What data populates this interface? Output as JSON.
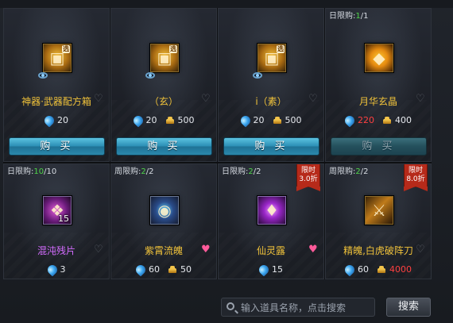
{
  "colors": {
    "item_name": "#f0c23a",
    "item_name_purple": "#d46cff",
    "limit_current": "#4fd44a",
    "price_red": "#ff4040",
    "buy_button": "#2c8fb5",
    "ribbon": "#b62a1a"
  },
  "currency_icons": {
    "gem": "gem-icon",
    "gold": "gold-icon"
  },
  "items": [
    {
      "name": "神器·武器配方箱",
      "icon": "weapon-recipe-chest-icon",
      "tag": "选",
      "gem_price": "20",
      "buy_label": "购 买"
    },
    {
      "name": "（玄）",
      "icon": "xuan-chest-icon",
      "tag": "选",
      "gem_price": "20",
      "gold_price": "500",
      "buy_label": "购 买"
    },
    {
      "name": "i（素）",
      "icon": "su-chest-icon",
      "tag": "选",
      "gem_price": "20",
      "gold_price": "500",
      "buy_label": "购 买"
    },
    {
      "name": "月华玄晶",
      "icon": "moon-crystal-icon",
      "limit_label": "日限购:",
      "limit_current": "1",
      "limit_total": "1",
      "gem_price": "220",
      "gold_price": "400",
      "buy_label": "购 买"
    },
    {
      "name": "混沌残片",
      "icon": "chaos-fragment-icon",
      "qty": "15",
      "limit_label": "日限购:",
      "limit_current": "10",
      "limit_total": "10",
      "gem_price": "3"
    },
    {
      "name": "紫霄流魄",
      "icon": "zixiao-soul-icon",
      "limit_label": "周限购:",
      "limit_current": "2",
      "limit_total": "2",
      "gem_price": "60",
      "gold_price": "50"
    },
    {
      "name": "仙灵露",
      "icon": "fairy-dew-icon",
      "limit_label": "日限购:",
      "limit_current": "2",
      "limit_total": "2",
      "gem_price": "15",
      "ribbon_line1": "限时",
      "ribbon_line2": "3.0折"
    },
    {
      "name": "精魄,白虎破阵刀",
      "icon": "white-tiger-blade-icon",
      "limit_label": "周限购:",
      "limit_current": "2",
      "limit_total": "2",
      "gem_price": "60",
      "gold_price": "4000",
      "ribbon_line1": "限时",
      "ribbon_line2": "8.0折"
    }
  ],
  "search": {
    "placeholder": "输入道具名称，点击搜索",
    "button_label": "搜索"
  }
}
